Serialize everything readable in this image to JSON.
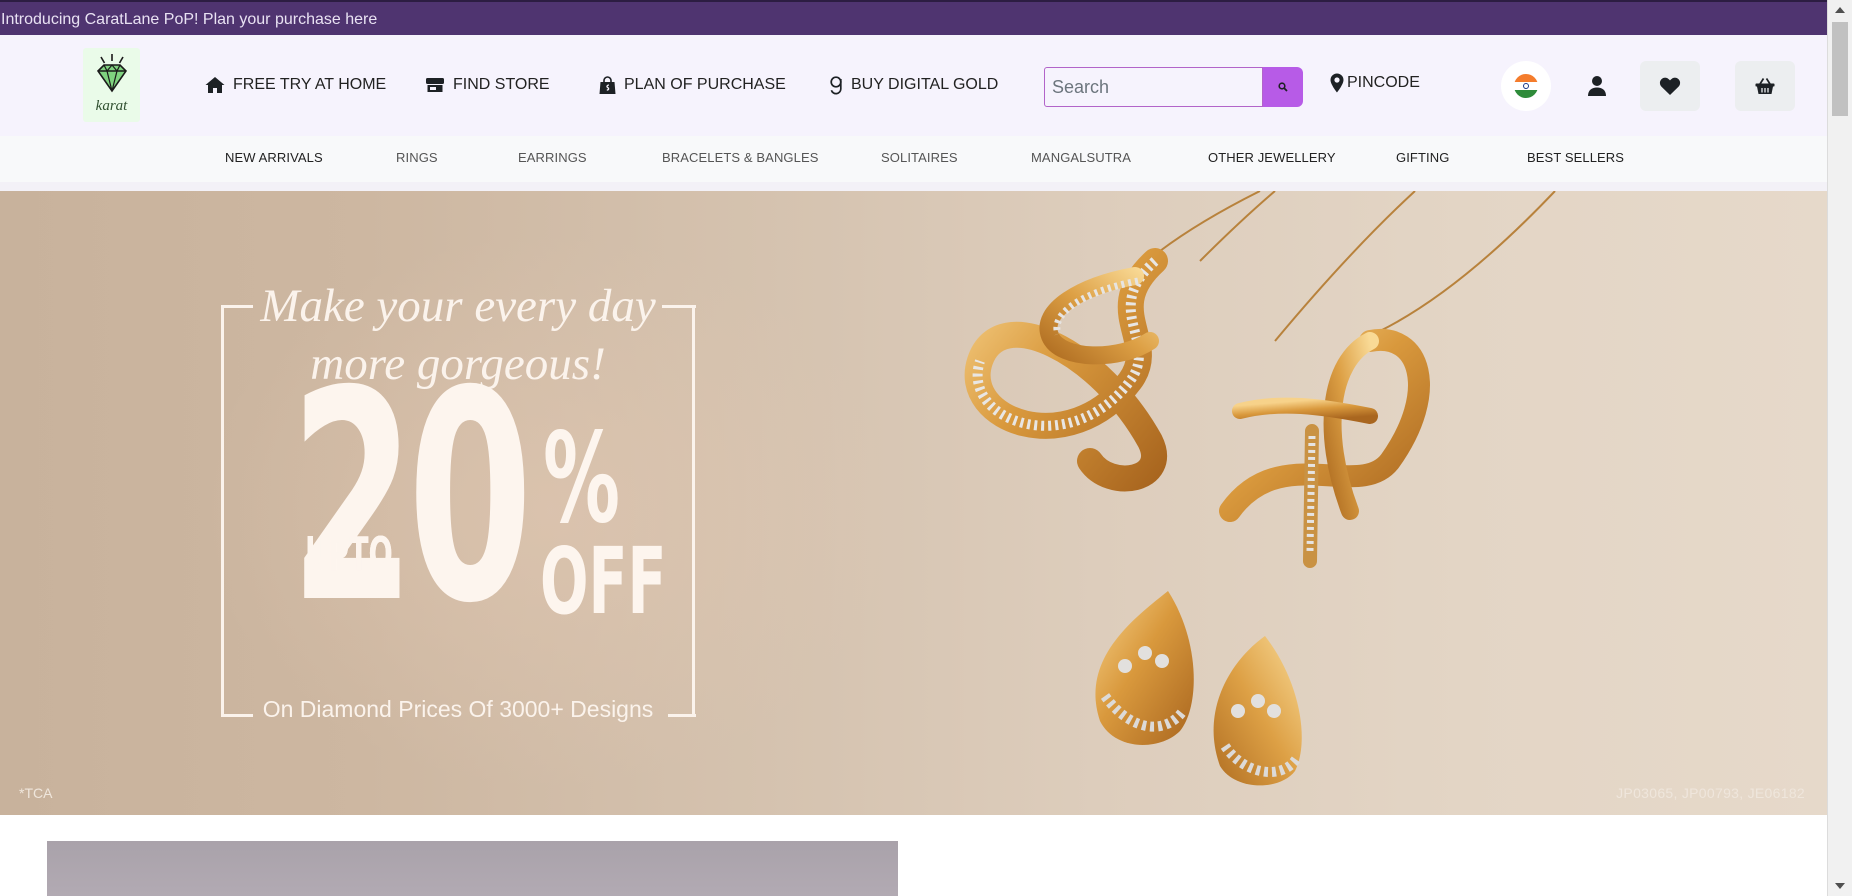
{
  "announcement": {
    "text": "Introducing CaratLane PoP! Plan your purchase here"
  },
  "header": {
    "logo": {
      "text": "karat",
      "icon": "diamond-icon"
    },
    "links": [
      {
        "label": "FREE TRY AT HOME",
        "icon": "home-icon"
      },
      {
        "label": "FIND STORE",
        "icon": "store-icon"
      },
      {
        "label": "PLAN OF PURCHASE",
        "icon": "shopping-bag-icon"
      },
      {
        "label": "BUY DIGITAL GOLD",
        "icon": "gold-g-icon"
      }
    ],
    "search": {
      "placeholder": "Search",
      "value": "",
      "button_icon": "search-icon"
    },
    "pincode": {
      "label": "PINCODE",
      "icon": "map-marker-icon"
    },
    "actions": [
      {
        "name": "country-flag",
        "icon": "india-flag-icon"
      },
      {
        "name": "account",
        "icon": "user-icon"
      },
      {
        "name": "wishlist",
        "icon": "heart-icon"
      },
      {
        "name": "cart",
        "icon": "basket-icon"
      }
    ]
  },
  "categories": [
    "NEW ARRIVALS",
    "RINGS",
    "EARRINGS",
    "BRACELETS & BANGLES",
    "SOLITAIRES",
    "MANGALSUTRA",
    "OTHER JEWELLERY",
    "GIFTING",
    "BEST SELLERS"
  ],
  "hero": {
    "headline_line1": "Make your every day",
    "headline_line2": "more gorgeous!",
    "upto": "UPTO",
    "number": "20",
    "percent": "%",
    "off": "OFF",
    "tagline": "On Diamond Prices Of 3000+ Designs",
    "disclaimer": "*TCA",
    "product_codes": "JP03065, JP00793, JE06182"
  },
  "colors": {
    "announcement_bg": "#4f3470",
    "header_bg": "#f6f3fd",
    "search_button": "#b75be7",
    "search_border": "#b264c9"
  }
}
